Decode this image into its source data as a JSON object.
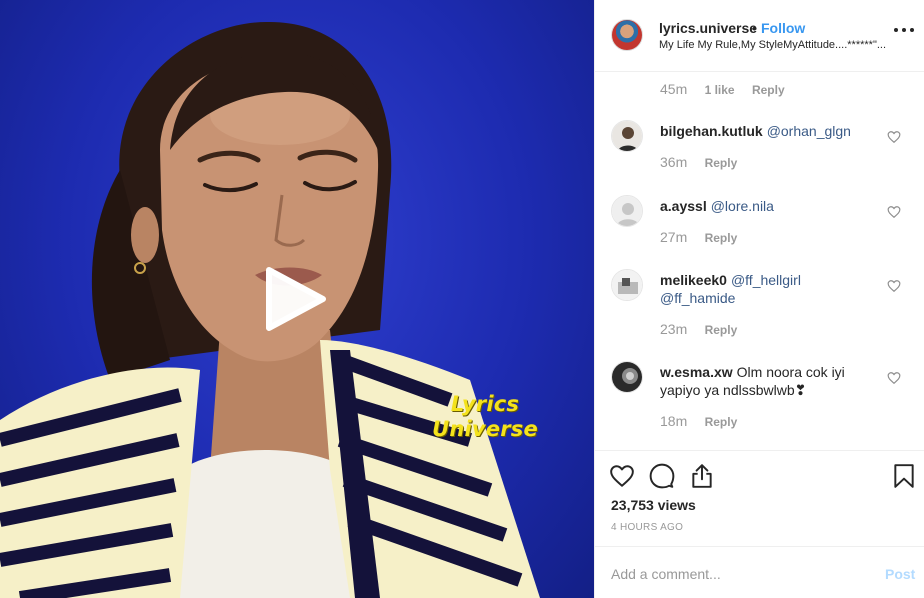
{
  "video": {
    "watermark_line1": "Lyrics",
    "watermark_line2": "Universe",
    "play_icon": "play-icon"
  },
  "header": {
    "username": "lyrics.universe",
    "separator": "•",
    "follow_label": "Follow",
    "caption": "My Life My Rule,My StyleMyAttitude....******\"...",
    "more_icon": "more-options-icon"
  },
  "comments": {
    "first_meta": {
      "time": "45m",
      "likes": "1 like",
      "reply": "Reply"
    },
    "items": [
      {
        "username": "bilgehan.kutluk",
        "mention": "@orhan_glgn",
        "text": "",
        "time": "36m",
        "reply": "Reply"
      },
      {
        "username": "a.ayssl",
        "mention": "@lore.nila",
        "text": "",
        "time": "27m",
        "reply": "Reply"
      },
      {
        "username": "melikeek0",
        "mention": "@ff_hellgirl",
        "mention2": "@ff_hamide",
        "text": "",
        "time": "23m",
        "reply": "Reply"
      },
      {
        "username": "w.esma.xw",
        "mention": "",
        "text": "Olm noora cok iyi yapiyo ya ndlssbwlwb❣",
        "time": "18m",
        "reply": "Reply"
      }
    ]
  },
  "actions": {
    "icons": [
      "heart-icon",
      "comment-icon",
      "share-icon",
      "bookmark-icon"
    ],
    "views": "23,753 views",
    "timestamp": "4 HOURS AGO"
  },
  "add_comment": {
    "placeholder": "Add a comment...",
    "post_label": "Post"
  },
  "colors": {
    "link_blue": "#3897f0",
    "post_disabled": "#b3dbff",
    "video_bg": "#1d2bb0",
    "watermark_yellow": "#f4e21c"
  }
}
